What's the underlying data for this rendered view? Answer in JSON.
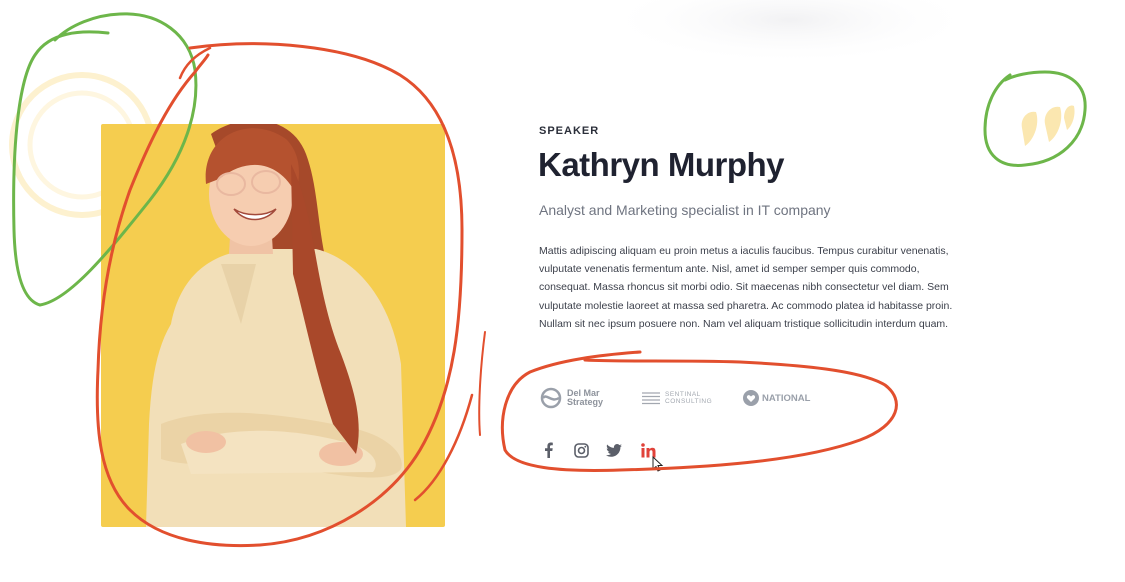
{
  "speaker": {
    "eyebrow": "SPEAKER",
    "name": "Kathryn Murphy",
    "role": "Analyst and Marketing specialist in IT company",
    "bio": "Mattis adipiscing aliquam eu proin metus a iaculis faucibus. Tempus curabitur venenatis, vulputate venenatis fermentum ante. Nisl, amet id semper semper quis commodo, consequat. Massa rhoncus sit morbi odio. Sit maecenas nibh consectetur vel diam. Sem vulputate molestie laoreet at massa sed pharetra. Ac commodo platea id habitasse proin. Nullam sit nec ipsum posuere non. Nam vel aliquam tristique sollicitudin interdum quam.",
    "photo_background": "#f5cd4f"
  },
  "logos": [
    {
      "icon": "wave-logo-icon",
      "line1": "Del Mar",
      "line2": "Strategy"
    },
    {
      "icon": "stripes-logo-icon",
      "line1": "SENTINAL",
      "line2": "CONSULTING"
    },
    {
      "icon": "heart-badge-icon",
      "text": "NATIONAL"
    }
  ],
  "socials": [
    {
      "name": "facebook-icon",
      "active": false,
      "color": "#5b5f69"
    },
    {
      "name": "instagram-icon",
      "active": false,
      "color": "#5b5f69"
    },
    {
      "name": "twitter-icon",
      "active": false,
      "color": "#5b5f69"
    },
    {
      "name": "linkedin-icon",
      "active": true,
      "color": "#e0423a"
    }
  ],
  "colors": {
    "accent_yellow": "#f5cd4f",
    "scribble_red": "#e24f2e",
    "scribble_green": "#6db64a",
    "quote_mark": "#fbe7b0"
  }
}
